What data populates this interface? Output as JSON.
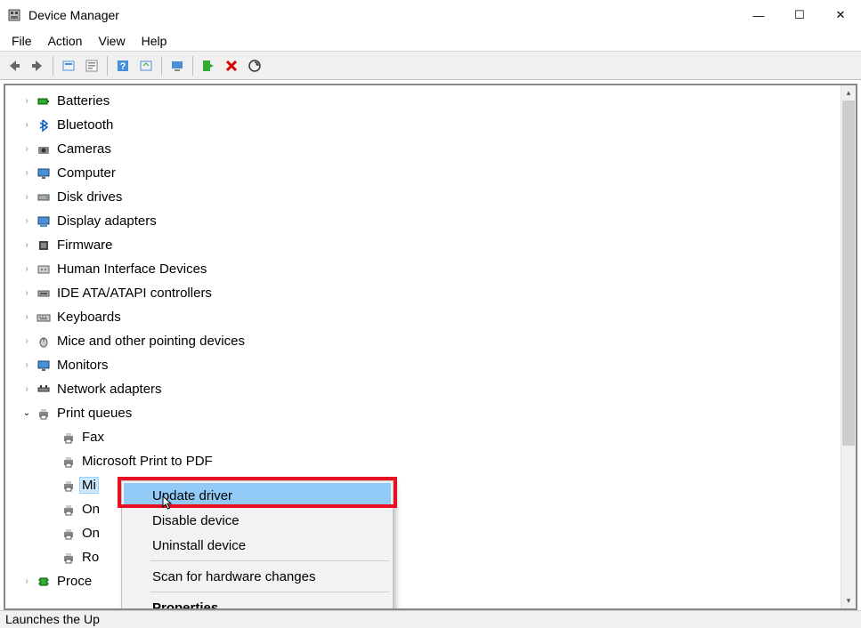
{
  "window": {
    "title": "Device Manager",
    "controls": {
      "minimize": "—",
      "maximize": "☐",
      "close": "✕"
    }
  },
  "menubar": {
    "items": [
      "File",
      "Action",
      "View",
      "Help"
    ]
  },
  "toolbar": {
    "icons": [
      {
        "name": "back-icon"
      },
      {
        "name": "forward-icon"
      },
      {
        "name": "show-hidden-icon"
      },
      {
        "name": "properties-icon"
      },
      {
        "name": "help-icon"
      },
      {
        "name": "resources-icon"
      },
      {
        "name": "computer-icon"
      },
      {
        "name": "update-driver-icon"
      },
      {
        "name": "uninstall-icon"
      },
      {
        "name": "scan-hardware-icon"
      }
    ]
  },
  "tree": {
    "nodes": [
      {
        "label": "Batteries",
        "icon": "battery-icon",
        "expandable": true
      },
      {
        "label": "Bluetooth",
        "icon": "bluetooth-icon",
        "expandable": true
      },
      {
        "label": "Cameras",
        "icon": "camera-icon",
        "expandable": true
      },
      {
        "label": "Computer",
        "icon": "monitor-icon",
        "expandable": true
      },
      {
        "label": "Disk drives",
        "icon": "disk-icon",
        "expandable": true
      },
      {
        "label": "Display adapters",
        "icon": "display-adapter-icon",
        "expandable": true
      },
      {
        "label": "Firmware",
        "icon": "firmware-icon",
        "expandable": true
      },
      {
        "label": "Human Interface Devices",
        "icon": "hid-icon",
        "expandable": true
      },
      {
        "label": "IDE ATA/ATAPI controllers",
        "icon": "ide-icon",
        "expandable": true
      },
      {
        "label": "Keyboards",
        "icon": "keyboard-icon",
        "expandable": true
      },
      {
        "label": "Mice and other pointing devices",
        "icon": "mouse-icon",
        "expandable": true
      },
      {
        "label": "Monitors",
        "icon": "monitor-icon",
        "expandable": true
      },
      {
        "label": "Network adapters",
        "icon": "network-icon",
        "expandable": true
      },
      {
        "label": "Print queues",
        "icon": "printer-icon",
        "expandable": true,
        "expanded": true,
        "children": [
          {
            "label": "Fax",
            "icon": "printer-icon"
          },
          {
            "label": "Microsoft Print to PDF",
            "icon": "printer-icon"
          },
          {
            "label": "Mi",
            "icon": "printer-icon",
            "selected": true
          },
          {
            "label": "On",
            "icon": "printer-icon"
          },
          {
            "label": "On",
            "icon": "printer-icon"
          },
          {
            "label": "Ro",
            "icon": "printer-icon"
          }
        ]
      },
      {
        "label": "Proce",
        "icon": "processor-icon",
        "expandable": true
      }
    ]
  },
  "context_menu": {
    "items": [
      {
        "label": "Update driver",
        "highlighted": true
      },
      {
        "label": "Disable device"
      },
      {
        "label": "Uninstall device"
      },
      {
        "type": "separator"
      },
      {
        "label": "Scan for hardware changes"
      },
      {
        "type": "separator"
      },
      {
        "label": "Properties",
        "bold": true
      }
    ]
  },
  "statusbar": {
    "text": "Launches the Up"
  }
}
